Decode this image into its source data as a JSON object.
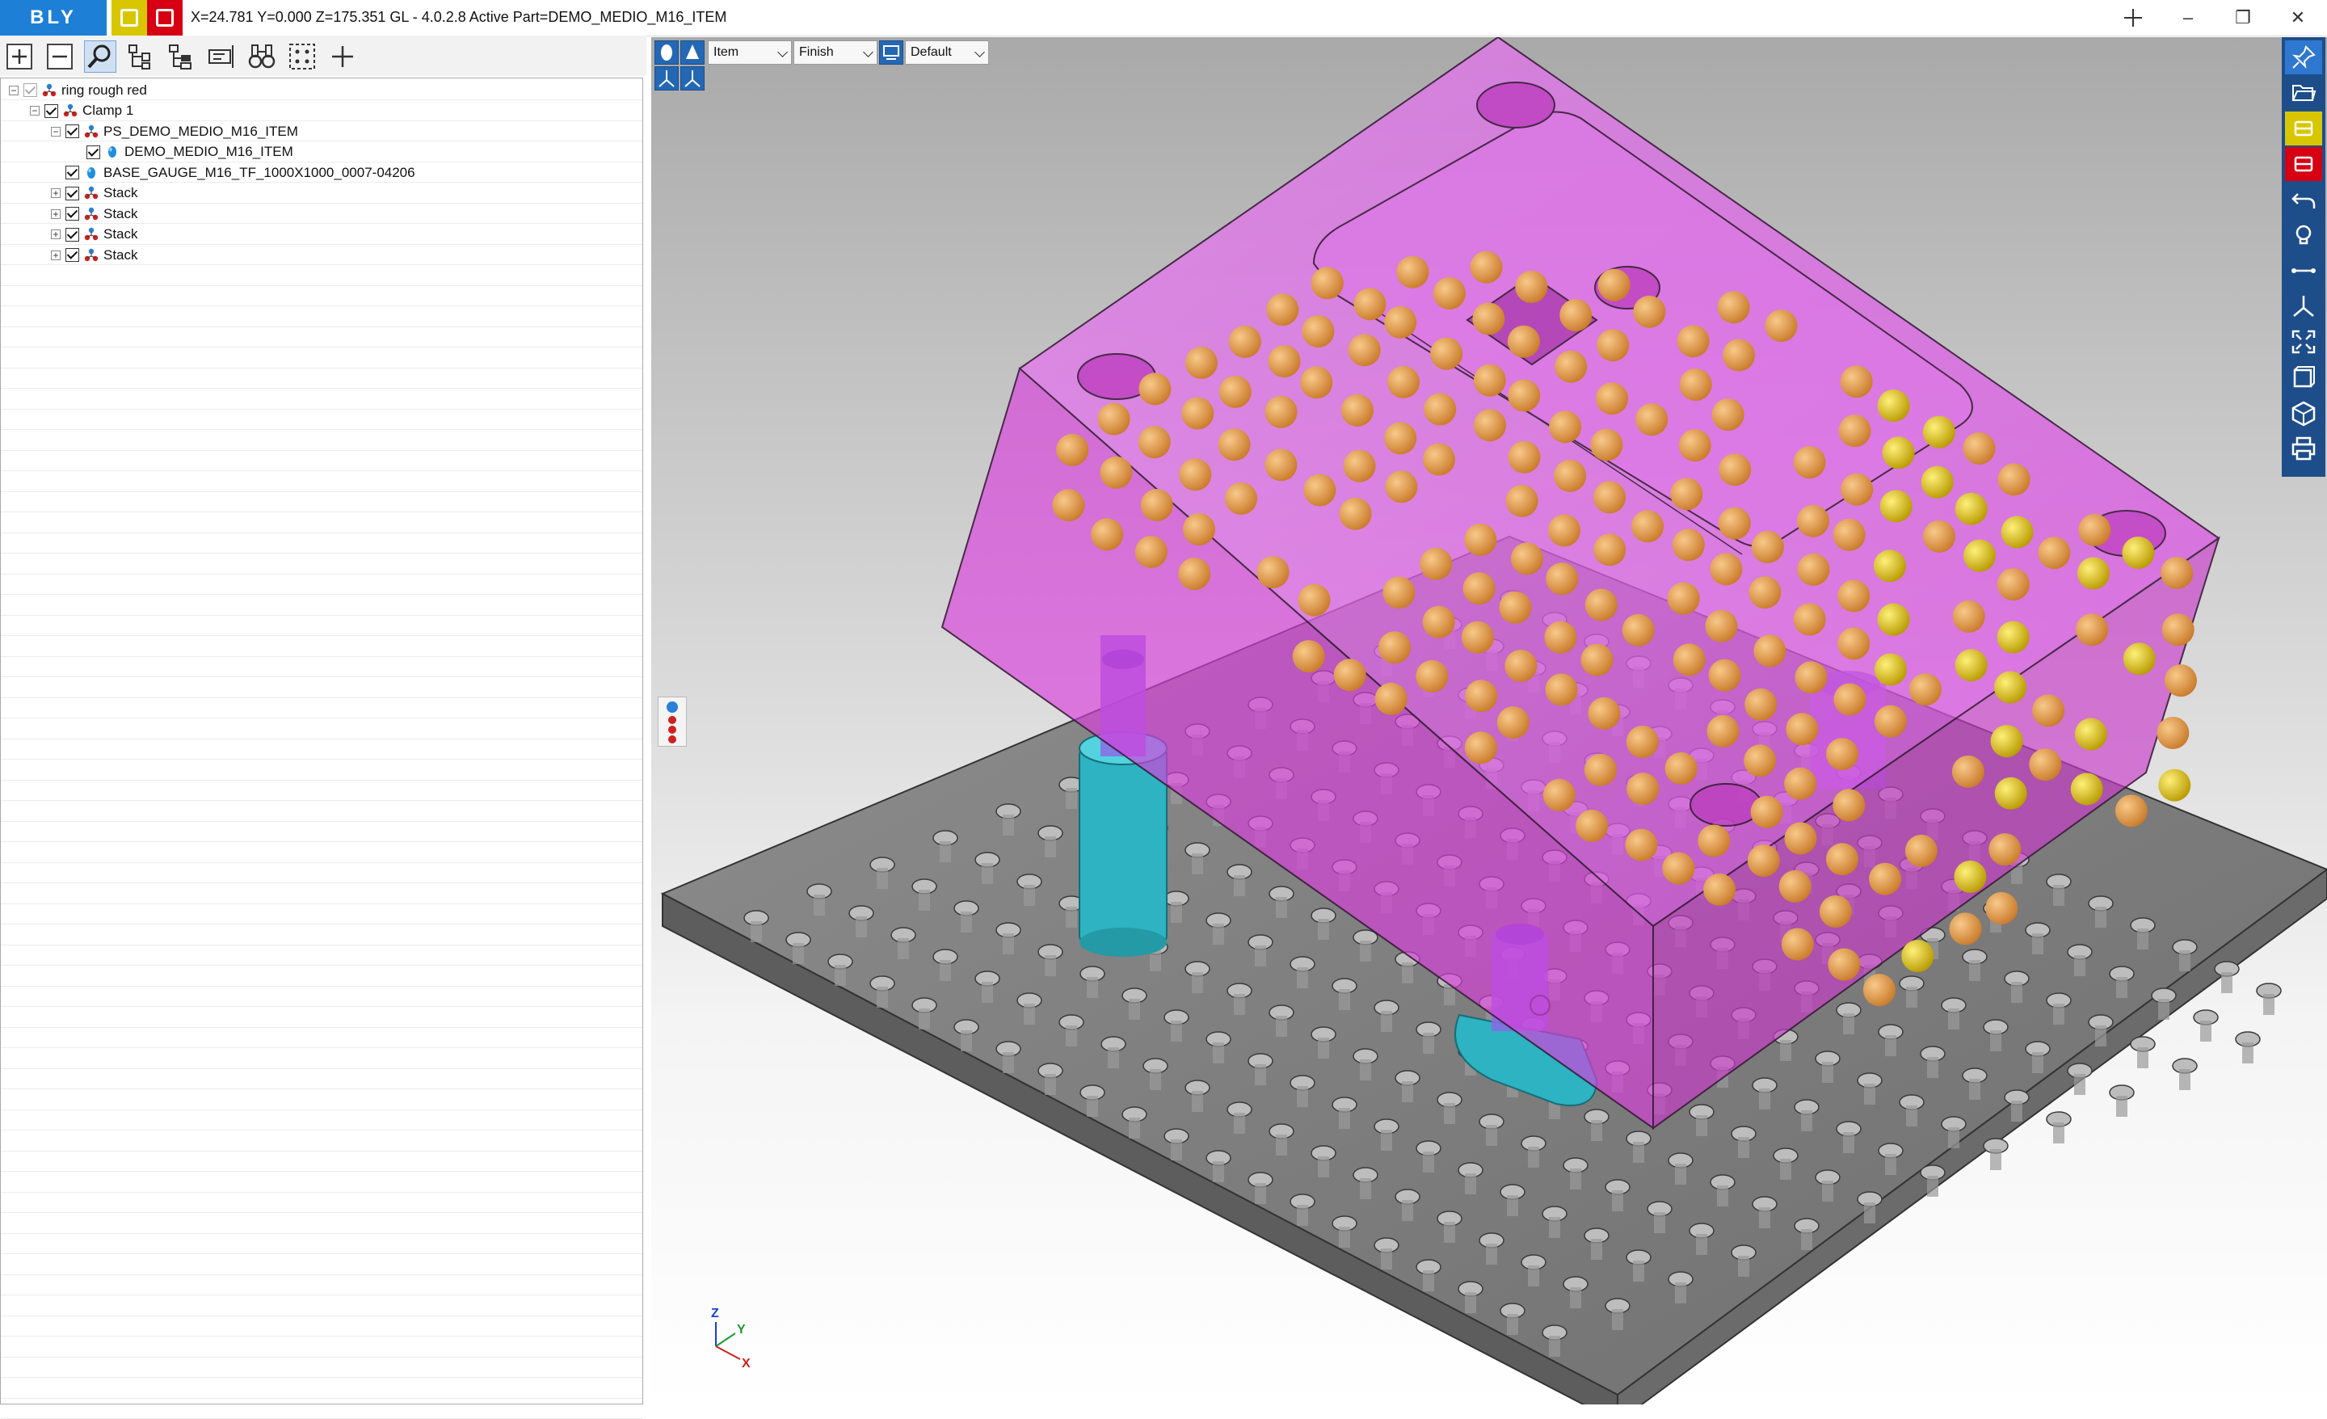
{
  "app": {
    "logo_text": "BLY",
    "title": "X=24.781 Y=0.000 Z=175.351   GL - 4.0.2.8 Active Part=DEMO_MEDIO_M16_ITEM",
    "window_controls": {
      "minimize": "–",
      "restore": "❐",
      "close": "✕"
    }
  },
  "toolbar": {
    "tools": [
      "expand-all",
      "collapse-all",
      "search",
      "tree-structure",
      "tree-branch",
      "properties",
      "binoculars",
      "fit-view",
      "add"
    ]
  },
  "tree": {
    "items": [
      {
        "label": "ring rough red",
        "level": 0,
        "expander": "−",
        "checked": true,
        "dim": true,
        "icon": "assembly-icon"
      },
      {
        "label": "Clamp 1",
        "level": 1,
        "expander": "−",
        "checked": true,
        "dim": false,
        "icon": "assembly-icon"
      },
      {
        "label": "PS_DEMO_MEDIO_M16_ITEM",
        "level": 2,
        "expander": "−",
        "checked": true,
        "dim": false,
        "icon": "assembly-icon"
      },
      {
        "label": "DEMO_MEDIO_M16_ITEM",
        "level": 3,
        "expander": "",
        "checked": true,
        "dim": false,
        "icon": "part-icon"
      },
      {
        "label": "BASE_GAUGE_M16_TF_1000X1000_0007-04206",
        "level": 2,
        "expander": "",
        "checked": true,
        "dim": false,
        "icon": "part-icon"
      },
      {
        "label": "Stack",
        "level": 2,
        "expander": "+",
        "checked": true,
        "dim": false,
        "icon": "assembly-icon"
      },
      {
        "label": "Stack",
        "level": 2,
        "expander": "+",
        "checked": true,
        "dim": false,
        "icon": "assembly-icon"
      },
      {
        "label": "Stack",
        "level": 2,
        "expander": "+",
        "checked": true,
        "dim": false,
        "icon": "assembly-icon"
      },
      {
        "label": "Stack",
        "level": 2,
        "expander": "+",
        "checked": true,
        "dim": false,
        "icon": "assembly-icon"
      }
    ]
  },
  "viewport": {
    "item_select": "Item",
    "finish_select": "Finish",
    "view_select": "Default",
    "axes": {
      "z": "Z",
      "y": "Y",
      "x": "X"
    },
    "colors": {
      "part": "#e04ce6",
      "plate": "#7d7d7d",
      "support": "#2fb7c4",
      "ball": "#e8a04a",
      "toolbar": "#1e4e8a"
    }
  },
  "right_tools": [
    "pin-icon",
    "folder-open-icon",
    "yellow-module-icon",
    "red-module-icon",
    "undo-icon",
    "lightbulb-icon",
    "measure-icon",
    "axis-icon",
    "fit-screen-icon",
    "box-view-icon",
    "iso-view-icon",
    "print-icon"
  ]
}
